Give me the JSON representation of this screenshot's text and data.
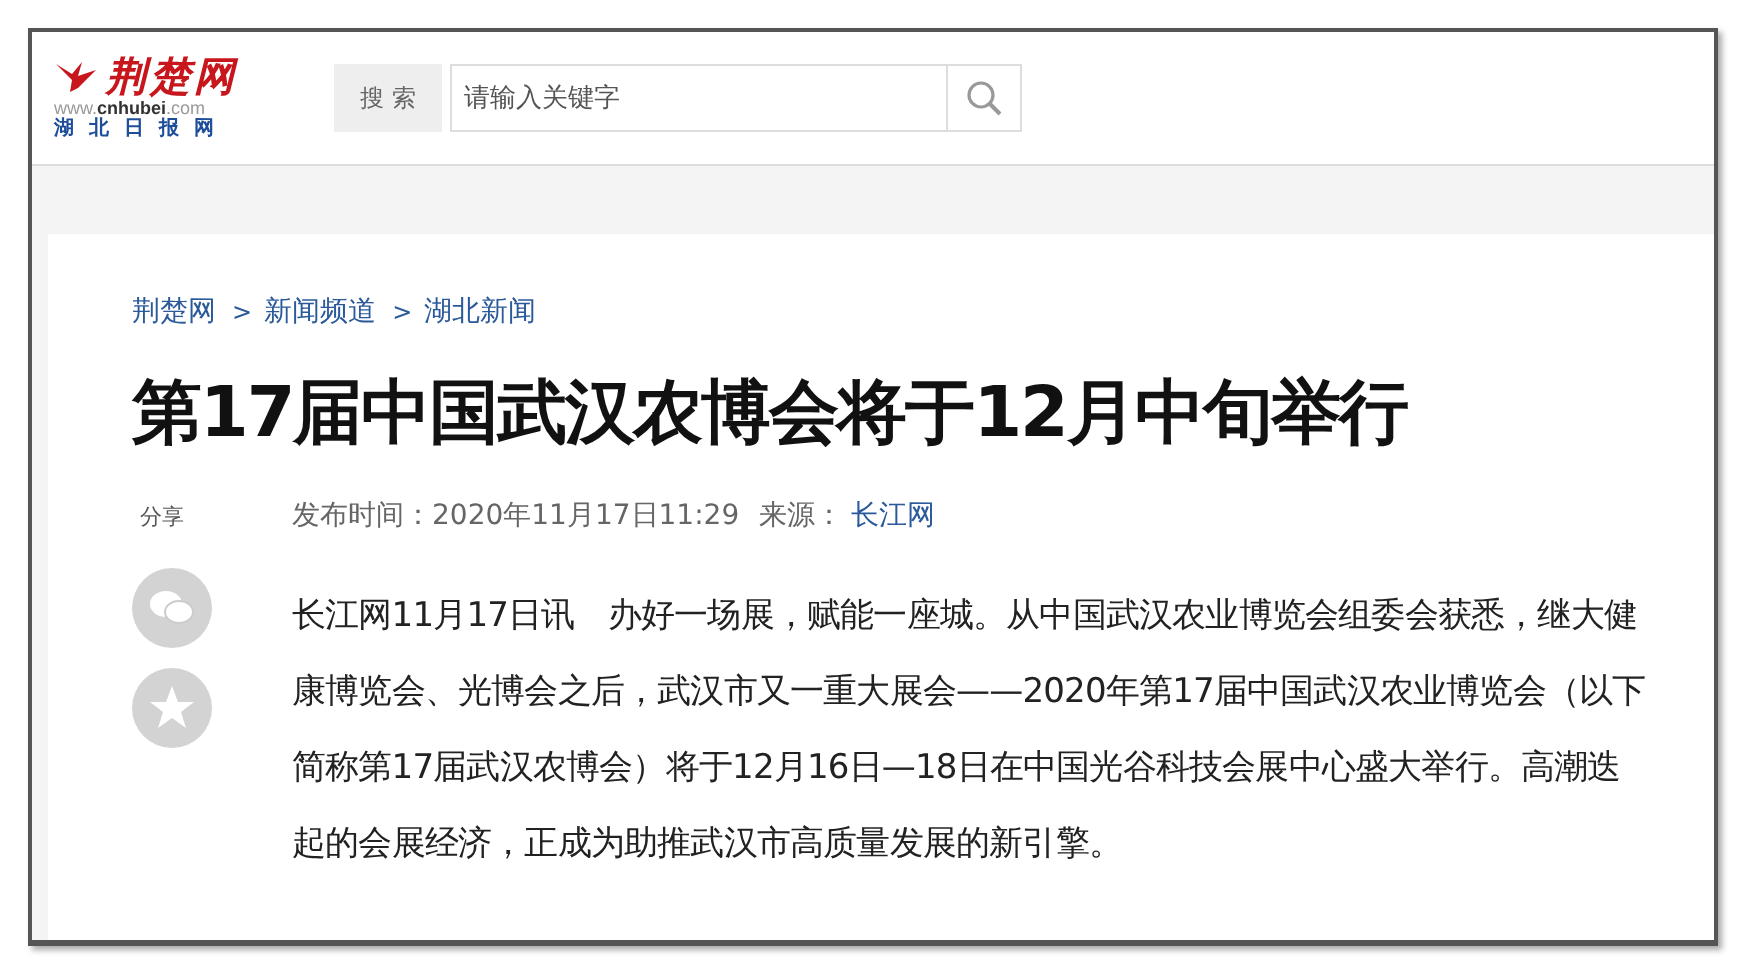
{
  "logo": {
    "name": "荆楚网",
    "domain_prefix": "www.",
    "domain_main": "cnhubei",
    "domain_suffix": ".com",
    "subtitle": "湖 北 日 报 网"
  },
  "search": {
    "label": "搜 索",
    "placeholder": "请输入关键字"
  },
  "breadcrumb": [
    "荆楚网",
    "新闻频道",
    "湖北新闻"
  ],
  "breadcrumb_separator": ">",
  "article": {
    "title": "第17届中国武汉农博会将于12月中旬举行",
    "published": "发布时间：2020年11月17日11:29",
    "source_label": "来源：",
    "source": "长江网",
    "paragraph": "长江网11月17日讯　办好一场展，赋能一座城。从中国武汉农业博览会组委会获悉，继大健康博览会、光博会之后，武汉市又一重大展会——2020年第17届中国武汉农业博览会（以下简称第17届武汉农博会）将于12月16日—18日在中国光谷科技会展中心盛大举行。高潮迭起的会展经济，正成为助推武汉市高质量发展的新引擎。"
  },
  "share": {
    "label": "分享",
    "buttons": [
      {
        "kind": "chat"
      },
      {
        "kind": "star"
      }
    ]
  }
}
